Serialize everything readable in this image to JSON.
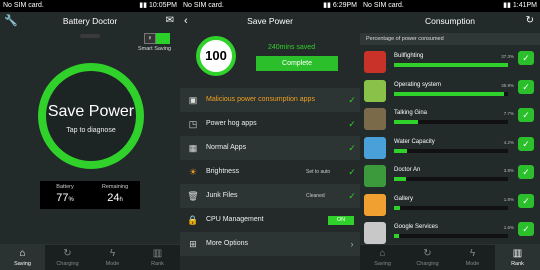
{
  "left": {
    "status": {
      "carrier": "No SIM card.",
      "time": "10:05PM"
    },
    "title": "Battery Doctor",
    "smart_saving_label": "Smart Saving",
    "ring": {
      "main": "Save Power",
      "sub": "Tap to diagnose"
    },
    "stats": {
      "battery_label": "Battery",
      "battery_value": "77",
      "battery_unit": "%",
      "remaining_label": "Remaining",
      "remaining_value": "24",
      "remaining_unit": "h"
    },
    "tabs": [
      "Saving",
      "Charging",
      "Mode",
      "Rank"
    ]
  },
  "middle": {
    "status": {
      "carrier": "No SIM card.",
      "time": "6:29PM"
    },
    "title": "Save Power",
    "score": "100",
    "saved": "240mins saved",
    "complete": "Complete",
    "rows": [
      {
        "label": "Malicious power consumption apps",
        "side": "",
        "icon": "shield-icon"
      },
      {
        "label": "Power hog apps",
        "side": "",
        "icon": "gauge-icon"
      },
      {
        "label": "Normal Apps",
        "side": "",
        "icon": "grid-icon"
      },
      {
        "label": "Brightness",
        "side": "Set to auto",
        "icon": "sun-icon"
      },
      {
        "label": "Junk Files",
        "side": "Cleaned",
        "icon": "trash-icon"
      },
      {
        "label": "CPU Management",
        "side": "ON",
        "icon": "lock-icon"
      },
      {
        "label": "More Options",
        "side": "",
        "icon": "apps-icon"
      }
    ]
  },
  "right": {
    "status": {
      "carrier": "No SIM card.",
      "time": "1:41PM"
    },
    "title": "Consumption",
    "header": "Percentage of power consumed",
    "apps": [
      {
        "name": "Bullfighting",
        "pct": "37.3%",
        "value": 37.3,
        "color": "#c83228"
      },
      {
        "name": "Operating system",
        "pct": "35.9%",
        "value": 35.9,
        "color": "#8ac249"
      },
      {
        "name": "Talking Gina",
        "pct": "7.7%",
        "value": 7.7,
        "color": "#7a6a4a"
      },
      {
        "name": "Water Capacity",
        "pct": "4.2%",
        "value": 4.2,
        "color": "#4aa0d8"
      },
      {
        "name": "Doctor An",
        "pct": "3.8%",
        "value": 3.8,
        "color": "#3c9a3c"
      },
      {
        "name": "Gallery",
        "pct": "1.8%",
        "value": 1.8,
        "color": "#f0a030"
      },
      {
        "name": "Google Services",
        "pct": "1.6%",
        "value": 1.6,
        "color": "#c8c8c8"
      },
      {
        "name": "",
        "pct": "",
        "value": 0,
        "color": "#5a4a3a"
      }
    ],
    "tabs": [
      "Saving",
      "Charging",
      "Mode",
      "Rank"
    ]
  }
}
